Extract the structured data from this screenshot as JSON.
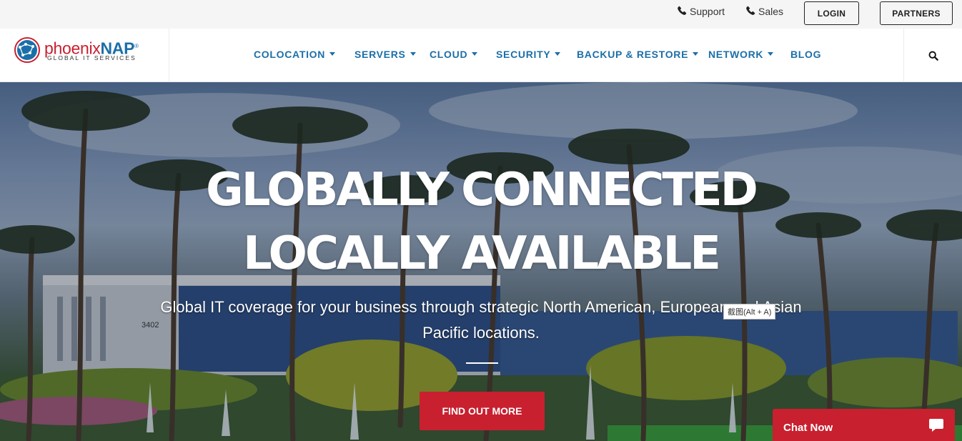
{
  "topbar": {
    "support": "Support",
    "sales": "Sales",
    "login": "LOGIN",
    "partners": "PARTNERS"
  },
  "logo": {
    "word_part1": "phoenix",
    "word_part2": "NAP",
    "trademark": "®",
    "tagline": "GLOBAL IT SERVICES"
  },
  "nav": {
    "items": [
      {
        "label": "COLOCATION",
        "icon": "chevron-down-icon"
      },
      {
        "label": "SERVERS",
        "icon": "chevron-down-icon"
      },
      {
        "label": "CLOUD",
        "icon": "chevron-down-icon"
      },
      {
        "label": "SECURITY",
        "icon": "chevron-down-icon"
      },
      {
        "label": "BACKUP & RESTORE",
        "icon": "chevron-down-icon"
      },
      {
        "label": "NETWORK",
        "icon": "chevron-down-icon"
      },
      {
        "label": "BLOG"
      }
    ],
    "search_icon": "search-icon"
  },
  "hero": {
    "title_line1": "GLOBALLY CONNECTED",
    "title_line2": "LOCALLY AVAILABLE",
    "subtitle": "Global IT coverage for your business through strategic North American, European and Asian Pacific locations.",
    "building_number": "3402",
    "cta": "FIND OUT MORE"
  },
  "tooltip": {
    "text": "截图(Alt + A)"
  },
  "chat": {
    "label": "Chat Now",
    "icon": "chat-bubble-icon"
  },
  "colors": {
    "brand_blue": "#1b6fa8",
    "brand_red": "#c8202f",
    "topbar_bg": "#f5f5f5"
  }
}
